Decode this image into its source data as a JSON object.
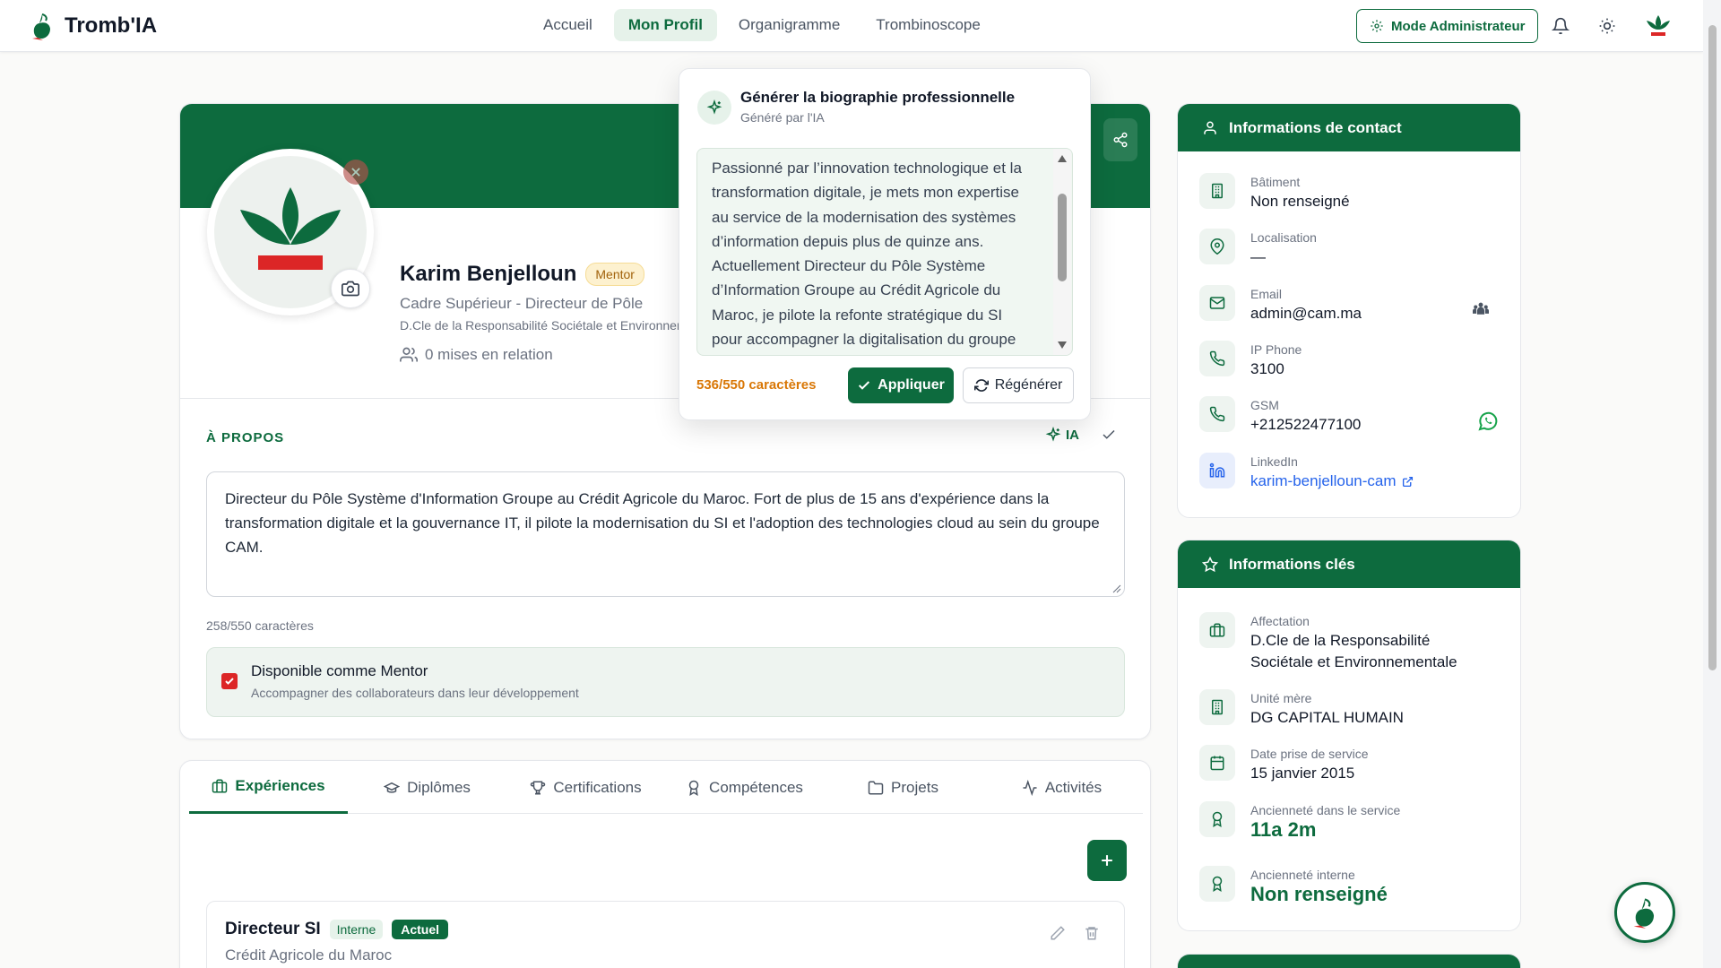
{
  "app": {
    "name": "Tromb'IA"
  },
  "nav": {
    "items": [
      {
        "label": "Accueil",
        "active": false
      },
      {
        "label": "Mon Profil",
        "active": true
      },
      {
        "label": "Organigramme",
        "active": false
      },
      {
        "label": "Trombinoscope",
        "active": false
      }
    ],
    "admin_label": "Mode Administrateur"
  },
  "profile": {
    "name": "Karim Benjelloun",
    "badge": "Mentor",
    "job_title": "Cadre Supérieur - Directeur de Pôle",
    "department": "D.Cle de la Responsabilité Sociétale et Environnementale",
    "relations": "0 mises en relation"
  },
  "about": {
    "title": "À PROPOS",
    "ia_label": "IA",
    "text": "Directeur du Pôle Système d'Information Groupe au Crédit Agricole du Maroc. Fort de plus de 15 ans d'expérience dans la transformation digitale et la gouvernance IT, il pilote la modernisation du SI et l'adoption des technologies cloud au sein du groupe CAM.",
    "count": "258/550 caractères",
    "mentor_label": "Disponible comme Mentor",
    "mentor_sub": "Accompagner des collaborateurs dans leur développement",
    "mentor_checked": true
  },
  "ai_popover": {
    "title": "Générer la biographie professionnelle",
    "subtitle": "Généré par l'IA",
    "text": "Passionné par l’innovation technologique et la transformation digitale, je mets mon expertise au service de la modernisation des systèmes d’information depuis plus de quinze ans. Actuellement Directeur du Pôle Système d’Information Groupe au Crédit Agricole du Maroc, je pilote la refonte stratégique du SI pour accompagner la digitalisation du groupe",
    "count": "536/550 caractères",
    "apply_label": "Appliquer",
    "regen_label": "Régénérer"
  },
  "tabs": [
    {
      "label": "Expériences",
      "icon": "briefcase-icon",
      "active": true
    },
    {
      "label": "Diplômes",
      "icon": "graduation-cap-icon",
      "active": false
    },
    {
      "label": "Certifications",
      "icon": "trophy-icon",
      "active": false
    },
    {
      "label": "Compétences",
      "icon": "award-icon",
      "active": false
    },
    {
      "label": "Projets",
      "icon": "folder-icon",
      "active": false
    },
    {
      "label": "Activités",
      "icon": "activity-icon",
      "active": false
    }
  ],
  "experience": {
    "title": "Directeur SI",
    "badge_type": "Interne",
    "badge_status": "Actuel",
    "company": "Crédit Agricole du Maroc"
  },
  "contact": {
    "title": "Informations de contact",
    "rows": [
      {
        "label": "Bâtiment",
        "value": "Non renseigné",
        "icon": "building-icon"
      },
      {
        "label": "Localisation",
        "value": "—",
        "icon": "map-pin-icon"
      },
      {
        "label": "Email",
        "value": "admin@cam.ma",
        "icon": "mail-icon"
      },
      {
        "label": "IP Phone",
        "value": "3100",
        "icon": "phone-icon"
      },
      {
        "label": "GSM",
        "value": "+212522477100",
        "icon": "phone-icon"
      },
      {
        "label": "LinkedIn",
        "value": "karim-benjelloun-cam",
        "icon": "linkedin-icon"
      }
    ]
  },
  "key_info": {
    "title": "Informations clés",
    "rows": [
      {
        "label": "Affectation",
        "value": "D.Cle de la Responsabilité Sociétale et Environnementale",
        "icon": "briefcase-icon"
      },
      {
        "label": "Unité mère",
        "value": "DG CAPITAL HUMAIN",
        "icon": "building-icon"
      },
      {
        "label": "Date prise de service",
        "value": "15 janvier 2015",
        "icon": "calendar-icon"
      },
      {
        "label": "Ancienneté dans le service",
        "value": "11a 2m",
        "icon": "award-icon"
      },
      {
        "label": "Ancienneté interne",
        "value": "Non renseigné",
        "icon": "award-icon"
      }
    ]
  },
  "colors": {
    "primary": "#0d6b3e",
    "accent_red": "#dc2626",
    "warning": "#d97706",
    "link": "#2563eb"
  }
}
